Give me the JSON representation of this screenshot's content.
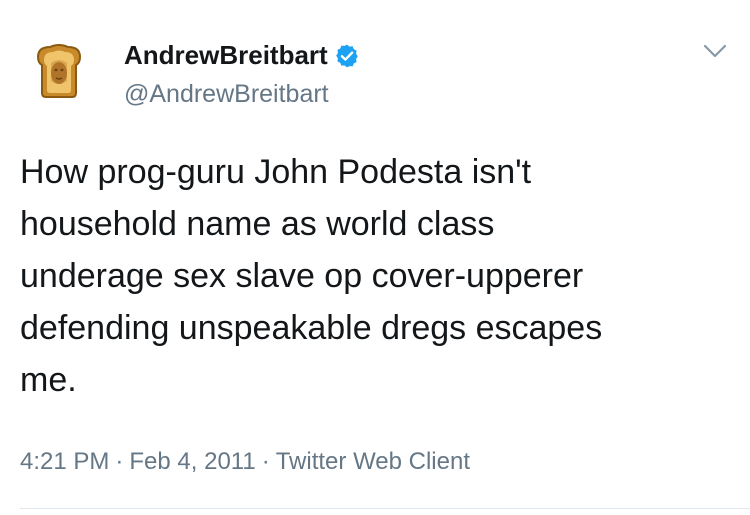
{
  "tweet": {
    "display_name": "AndrewBreitbart",
    "handle": "@AndrewBreitbart",
    "verified": true,
    "text": "How prog-guru John Podesta isn't\nhousehold name as world class\nunderage sex slave op cover-upperer\ndefending unspeakable dregs escapes\nme.",
    "time": "4:21 PM",
    "date": "Feb 4, 2011",
    "client": "Twitter Web Client",
    "separator": "·"
  },
  "icons": {
    "avatar": "toast-avatar",
    "verified": "verified-badge-icon",
    "menu": "chevron-down-icon"
  },
  "colors": {
    "text": "#14171a",
    "secondary": "#657786",
    "verified_blue": "#1da1f2",
    "divider": "#e1e8ed"
  }
}
